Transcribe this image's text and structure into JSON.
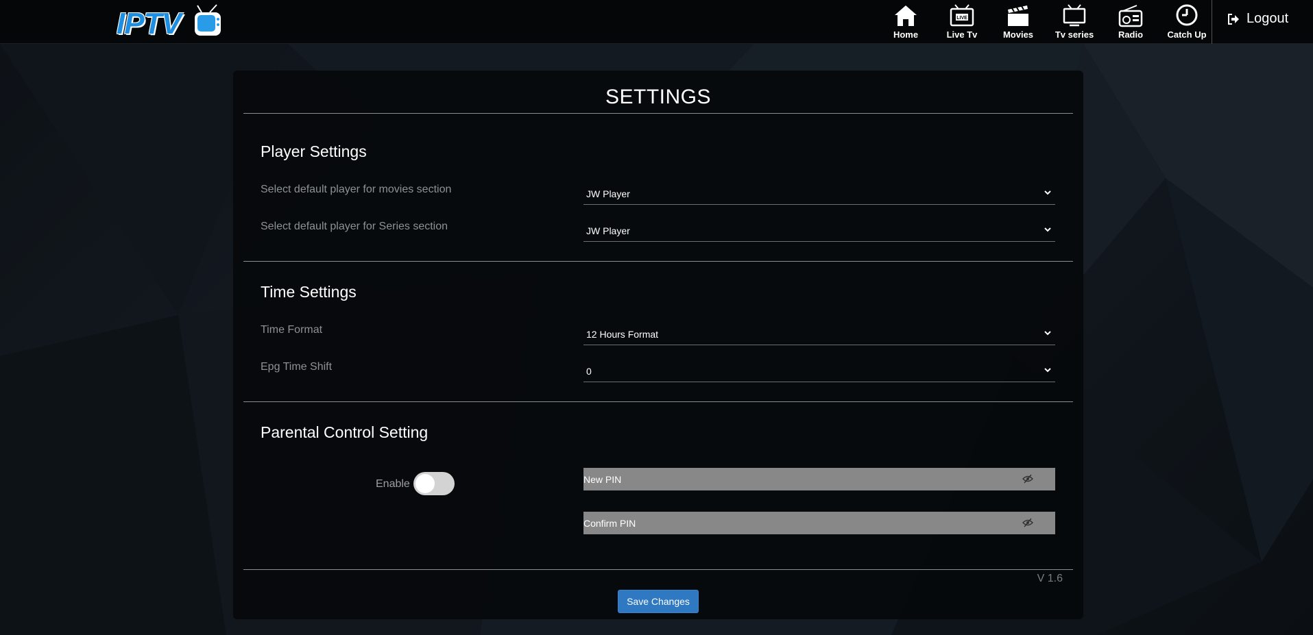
{
  "header": {
    "logo_text": "IPTV",
    "nav": [
      {
        "label": "Home",
        "icon": "home-icon"
      },
      {
        "label": "Live Tv",
        "icon": "live-tv-icon"
      },
      {
        "label": "Movies",
        "icon": "clapperboard-icon"
      },
      {
        "label": "Tv series",
        "icon": "tv-icon"
      },
      {
        "label": "Radio",
        "icon": "radio-icon"
      },
      {
        "label": "Catch Up",
        "icon": "clock-icon"
      }
    ],
    "logout_label": "Logout",
    "live_badge": "LIVE"
  },
  "settings": {
    "title": "SETTINGS",
    "player": {
      "title": "Player Settings",
      "movies_label": "Select default player for movies section",
      "movies_value": "JW Player",
      "series_label": "Select default player for Series section",
      "series_value": "JW Player"
    },
    "time": {
      "title": "Time Settings",
      "format_label": "Time Format",
      "format_value": "12 Hours Format",
      "shift_label": "Epg Time Shift",
      "shift_value": "0"
    },
    "parental": {
      "title": "Parental Control Setting",
      "enable_label": "Enable",
      "enabled": false,
      "new_pin_placeholder": "New PIN",
      "confirm_pin_placeholder": "Confirm PIN"
    },
    "version": "V 1.6",
    "save_label": "Save Changes"
  },
  "colors": {
    "accent": "#2f78c2",
    "logo_blue": "#1e8fe0",
    "pin_field_bg": "#888888"
  }
}
